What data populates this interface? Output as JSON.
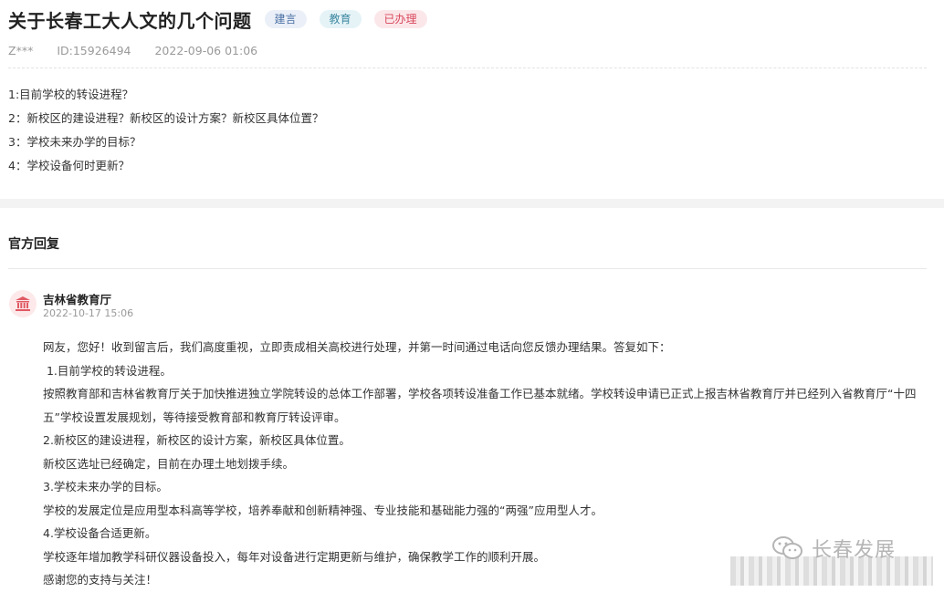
{
  "post": {
    "title": "关于长春工大人文的几个问题",
    "tags": [
      {
        "label": "建言",
        "color": "#4a6fa3"
      },
      {
        "label": "教育",
        "color": "#3f8aa2"
      },
      {
        "label": "已办理",
        "color": "#d9475c"
      }
    ],
    "user": "Z***",
    "id": "ID:15926494",
    "datetime": "2022-09-06 01:06",
    "questions": [
      "1:目前学校的转设进程？",
      "2：新校区的建设进程？新校区的设计方案？新校区具体位置？",
      "3：学校未来办学的目标？",
      "4：学校设备何时更新？"
    ]
  },
  "reply": {
    "heading": "官方回复",
    "org": "吉林省教育厅",
    "date": "2022-10-17 15:06",
    "paragraphs": [
      "网友，您好！收到留言后，我们高度重视，立即责成相关高校进行处理，并第一时间通过电话向您反馈办理结果。答复如下：",
      " 1.目前学校的转设进程。",
      "按照教育部和吉林省教育厅关于加快推进独立学院转设的总体工作部署，学校各项转设准备工作已基本就绪。学校转设申请已正式上报吉林省教育厅并已经列入省教育厅“十四五”学校设置发展规划，等待接受教育部和教育厅转设评审。",
      "2.新校区的建设进程，新校区的设计方案，新校区具体位置。",
      "新校区选址已经确定，目前在办理土地划拨手续。",
      "3.学校未来办学的目标。",
      "学校的发展定位是应用型本科高等学校，培养奉献和创新精神强、专业技能和基础能力强的“两强”应用型人才。",
      "4.学校设备合适更新。",
      "学校逐年增加教学科研仪器设备投入，每年对设备进行定期更新与维护，确保教学工作的顺利开展。",
      "感谢您的支持与关注！"
    ]
  },
  "watermark": {
    "text": "长春发展",
    "icon": "wechat-icon"
  },
  "colors": {
    "accent_red": "#d9475c",
    "avatar_bg": "#fde9ea",
    "avatar_icon": "#e05a64"
  }
}
